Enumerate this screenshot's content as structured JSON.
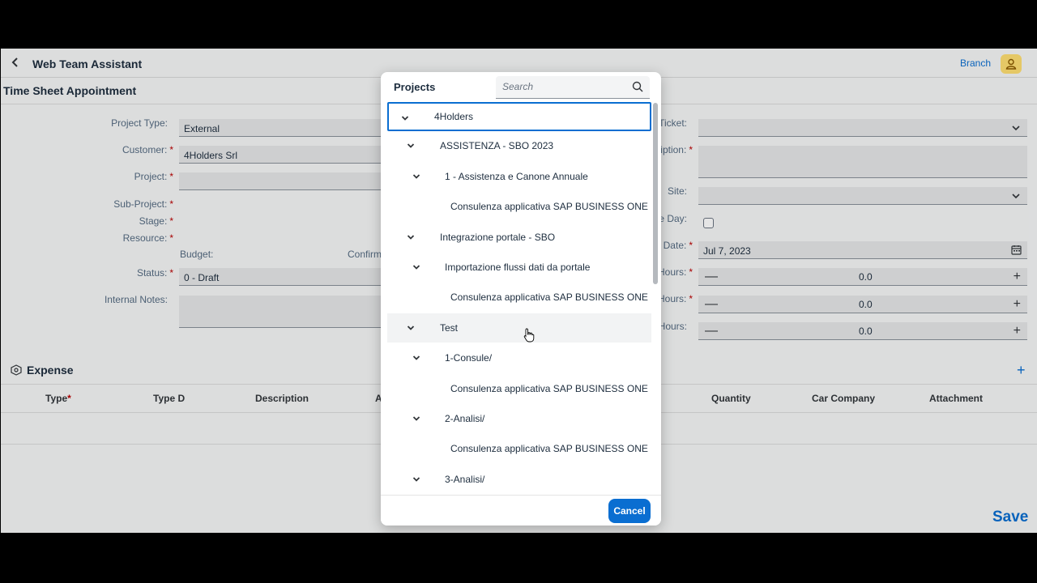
{
  "header": {
    "back_label": "‹",
    "title": "Web Team Assistant",
    "branch_label": "Branch",
    "user_icon": "user-icon"
  },
  "page": {
    "title": "Time Sheet Appointment"
  },
  "form_left": {
    "project_type": {
      "label": "Project Type:",
      "value": "External"
    },
    "customer": {
      "label": "Customer:",
      "value": "4Holders Srl",
      "required": "*"
    },
    "project": {
      "label": "Project:",
      "value": "",
      "required": "*"
    },
    "sub_project": {
      "label": "Sub-Project:",
      "required": "*"
    },
    "stage": {
      "label": "Stage:",
      "required": "*"
    },
    "resource": {
      "label": "Resource:",
      "required": "*"
    },
    "budget_label": "Budget:",
    "confirm_label": "Confirm",
    "status": {
      "label": "Status:",
      "value": "0 - Draft",
      "required": "*"
    },
    "internal_notes": {
      "label": "Internal Notes:",
      "value": ""
    }
  },
  "form_right": {
    "ticket": {
      "label": "Ticket:"
    },
    "description": {
      "label": "iption:",
      "required": "*"
    },
    "site": {
      "label": "Site:"
    },
    "full_day": {
      "label": "e Day:"
    },
    "date": {
      "label": "Date:",
      "value": "Jul 7, 2023",
      "required": "*"
    },
    "hours_1": {
      "label": "Hours:",
      "value": "0.0",
      "required": "*"
    },
    "hours_2": {
      "label": "Hours:",
      "value": "0.0",
      "required": "*"
    },
    "hours_3": {
      "label": "Hours:",
      "value": "0.0"
    }
  },
  "expense": {
    "title": "Expense",
    "columns": [
      "Type",
      "Type D",
      "Description",
      "A",
      "Quantity",
      "Car Company",
      "Attachment"
    ],
    "type_required": "*"
  },
  "footer": {
    "save_label": "Save"
  },
  "dialog": {
    "title": "Projects",
    "search_placeholder": "Search",
    "items": [
      {
        "label": "4Holders",
        "level": 0,
        "expanded": true,
        "selected": true
      },
      {
        "label": "ASSISTENZA - SBO 2023",
        "level": 1,
        "expanded": true
      },
      {
        "label": "1 - Assistenza e Canone Annuale",
        "level": 2,
        "expanded": true
      },
      {
        "label": "Consulenza applicativa SAP BUSINESS ONE",
        "level": 3
      },
      {
        "label": "Integrazione portale  - SBO",
        "level": 1,
        "expanded": true
      },
      {
        "label": "Importazione flussi dati da portale",
        "level": 2,
        "expanded": true
      },
      {
        "label": "Consulenza applicativa SAP BUSINESS ONE",
        "level": 3
      },
      {
        "label": "Test",
        "level": 1,
        "expanded": true,
        "hover": true
      },
      {
        "label": "1-Consule/",
        "level": 2,
        "expanded": true
      },
      {
        "label": "Consulenza applicativa SAP BUSINESS ONE",
        "level": 3
      },
      {
        "label": "2-Analisi/",
        "level": 2,
        "expanded": true
      },
      {
        "label": "Consulenza applicativa SAP BUSINESS ONE",
        "level": 3
      },
      {
        "label": "3-Analisi/",
        "level": 2,
        "expanded": true
      }
    ],
    "cancel_label": "Cancel"
  }
}
